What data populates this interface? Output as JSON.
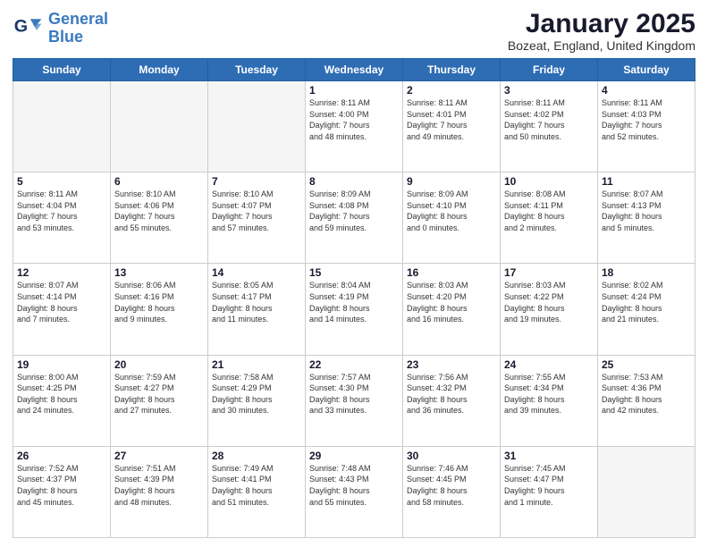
{
  "logo": {
    "line1": "General",
    "line2": "Blue"
  },
  "title": "January 2025",
  "subtitle": "Bozeat, England, United Kingdom",
  "weekdays": [
    "Sunday",
    "Monday",
    "Tuesday",
    "Wednesday",
    "Thursday",
    "Friday",
    "Saturday"
  ],
  "days": [
    {
      "num": "",
      "info": "",
      "empty": true
    },
    {
      "num": "",
      "info": "",
      "empty": true
    },
    {
      "num": "",
      "info": "",
      "empty": true
    },
    {
      "num": "1",
      "info": "Sunrise: 8:11 AM\nSunset: 4:00 PM\nDaylight: 7 hours\nand 48 minutes."
    },
    {
      "num": "2",
      "info": "Sunrise: 8:11 AM\nSunset: 4:01 PM\nDaylight: 7 hours\nand 49 minutes."
    },
    {
      "num": "3",
      "info": "Sunrise: 8:11 AM\nSunset: 4:02 PM\nDaylight: 7 hours\nand 50 minutes."
    },
    {
      "num": "4",
      "info": "Sunrise: 8:11 AM\nSunset: 4:03 PM\nDaylight: 7 hours\nand 52 minutes."
    },
    {
      "num": "5",
      "info": "Sunrise: 8:11 AM\nSunset: 4:04 PM\nDaylight: 7 hours\nand 53 minutes."
    },
    {
      "num": "6",
      "info": "Sunrise: 8:10 AM\nSunset: 4:06 PM\nDaylight: 7 hours\nand 55 minutes."
    },
    {
      "num": "7",
      "info": "Sunrise: 8:10 AM\nSunset: 4:07 PM\nDaylight: 7 hours\nand 57 minutes."
    },
    {
      "num": "8",
      "info": "Sunrise: 8:09 AM\nSunset: 4:08 PM\nDaylight: 7 hours\nand 59 minutes."
    },
    {
      "num": "9",
      "info": "Sunrise: 8:09 AM\nSunset: 4:10 PM\nDaylight: 8 hours\nand 0 minutes."
    },
    {
      "num": "10",
      "info": "Sunrise: 8:08 AM\nSunset: 4:11 PM\nDaylight: 8 hours\nand 2 minutes."
    },
    {
      "num": "11",
      "info": "Sunrise: 8:07 AM\nSunset: 4:13 PM\nDaylight: 8 hours\nand 5 minutes."
    },
    {
      "num": "12",
      "info": "Sunrise: 8:07 AM\nSunset: 4:14 PM\nDaylight: 8 hours\nand 7 minutes."
    },
    {
      "num": "13",
      "info": "Sunrise: 8:06 AM\nSunset: 4:16 PM\nDaylight: 8 hours\nand 9 minutes."
    },
    {
      "num": "14",
      "info": "Sunrise: 8:05 AM\nSunset: 4:17 PM\nDaylight: 8 hours\nand 11 minutes."
    },
    {
      "num": "15",
      "info": "Sunrise: 8:04 AM\nSunset: 4:19 PM\nDaylight: 8 hours\nand 14 minutes."
    },
    {
      "num": "16",
      "info": "Sunrise: 8:03 AM\nSunset: 4:20 PM\nDaylight: 8 hours\nand 16 minutes."
    },
    {
      "num": "17",
      "info": "Sunrise: 8:03 AM\nSunset: 4:22 PM\nDaylight: 8 hours\nand 19 minutes."
    },
    {
      "num": "18",
      "info": "Sunrise: 8:02 AM\nSunset: 4:24 PM\nDaylight: 8 hours\nand 21 minutes."
    },
    {
      "num": "19",
      "info": "Sunrise: 8:00 AM\nSunset: 4:25 PM\nDaylight: 8 hours\nand 24 minutes."
    },
    {
      "num": "20",
      "info": "Sunrise: 7:59 AM\nSunset: 4:27 PM\nDaylight: 8 hours\nand 27 minutes."
    },
    {
      "num": "21",
      "info": "Sunrise: 7:58 AM\nSunset: 4:29 PM\nDaylight: 8 hours\nand 30 minutes."
    },
    {
      "num": "22",
      "info": "Sunrise: 7:57 AM\nSunset: 4:30 PM\nDaylight: 8 hours\nand 33 minutes."
    },
    {
      "num": "23",
      "info": "Sunrise: 7:56 AM\nSunset: 4:32 PM\nDaylight: 8 hours\nand 36 minutes."
    },
    {
      "num": "24",
      "info": "Sunrise: 7:55 AM\nSunset: 4:34 PM\nDaylight: 8 hours\nand 39 minutes."
    },
    {
      "num": "25",
      "info": "Sunrise: 7:53 AM\nSunset: 4:36 PM\nDaylight: 8 hours\nand 42 minutes."
    },
    {
      "num": "26",
      "info": "Sunrise: 7:52 AM\nSunset: 4:37 PM\nDaylight: 8 hours\nand 45 minutes."
    },
    {
      "num": "27",
      "info": "Sunrise: 7:51 AM\nSunset: 4:39 PM\nDaylight: 8 hours\nand 48 minutes."
    },
    {
      "num": "28",
      "info": "Sunrise: 7:49 AM\nSunset: 4:41 PM\nDaylight: 8 hours\nand 51 minutes."
    },
    {
      "num": "29",
      "info": "Sunrise: 7:48 AM\nSunset: 4:43 PM\nDaylight: 8 hours\nand 55 minutes."
    },
    {
      "num": "30",
      "info": "Sunrise: 7:46 AM\nSunset: 4:45 PM\nDaylight: 8 hours\nand 58 minutes."
    },
    {
      "num": "31",
      "info": "Sunrise: 7:45 AM\nSunset: 4:47 PM\nDaylight: 9 hours\nand 1 minute."
    },
    {
      "num": "",
      "info": "",
      "empty": true
    }
  ]
}
